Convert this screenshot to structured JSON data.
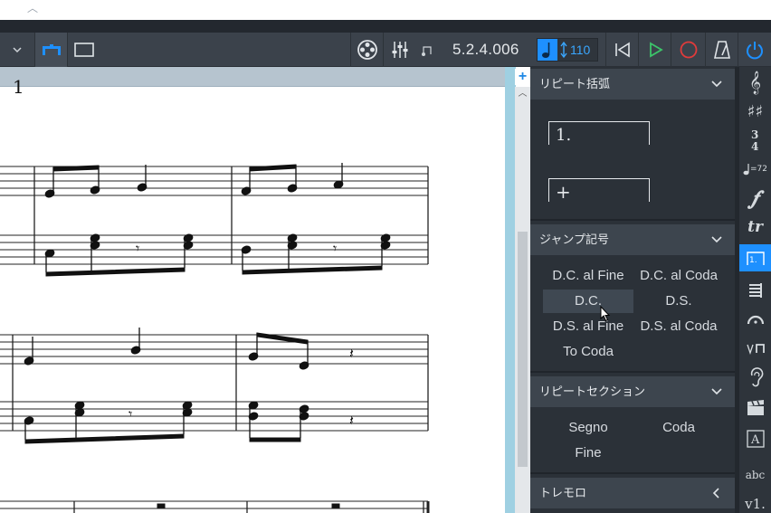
{
  "toolbar": {
    "position_counter": "5.2.4.006",
    "tempo_value": "110"
  },
  "score": {
    "first_measure_number": "1"
  },
  "panel": {
    "repeat_brackets": {
      "title": "リピート括弧",
      "items": [
        "1.",
        "+"
      ]
    },
    "jump_symbols": {
      "title": "ジャンプ記号",
      "items": [
        "D.C. al Fine",
        "D.C. al Coda",
        "D.C.",
        "D.S.",
        "D.S. al Fine",
        "D.S. al Coda",
        "To Coda"
      ],
      "hovered": "D.C."
    },
    "repeat_sections": {
      "title": "リピートセクション",
      "items": [
        "Segno",
        "Coda",
        "Fine"
      ]
    },
    "tremolo": {
      "title": "トレモロ"
    }
  },
  "icon_column": {
    "tempo_label": "=72",
    "abc_label": "abc",
    "v1_label": "v1."
  },
  "colors": {
    "accent": "#1e90ff",
    "play_green": "#3cc46a",
    "record_red": "#e03b3b",
    "panel_bg": "#2b3138",
    "section_header": "#3d454e"
  }
}
